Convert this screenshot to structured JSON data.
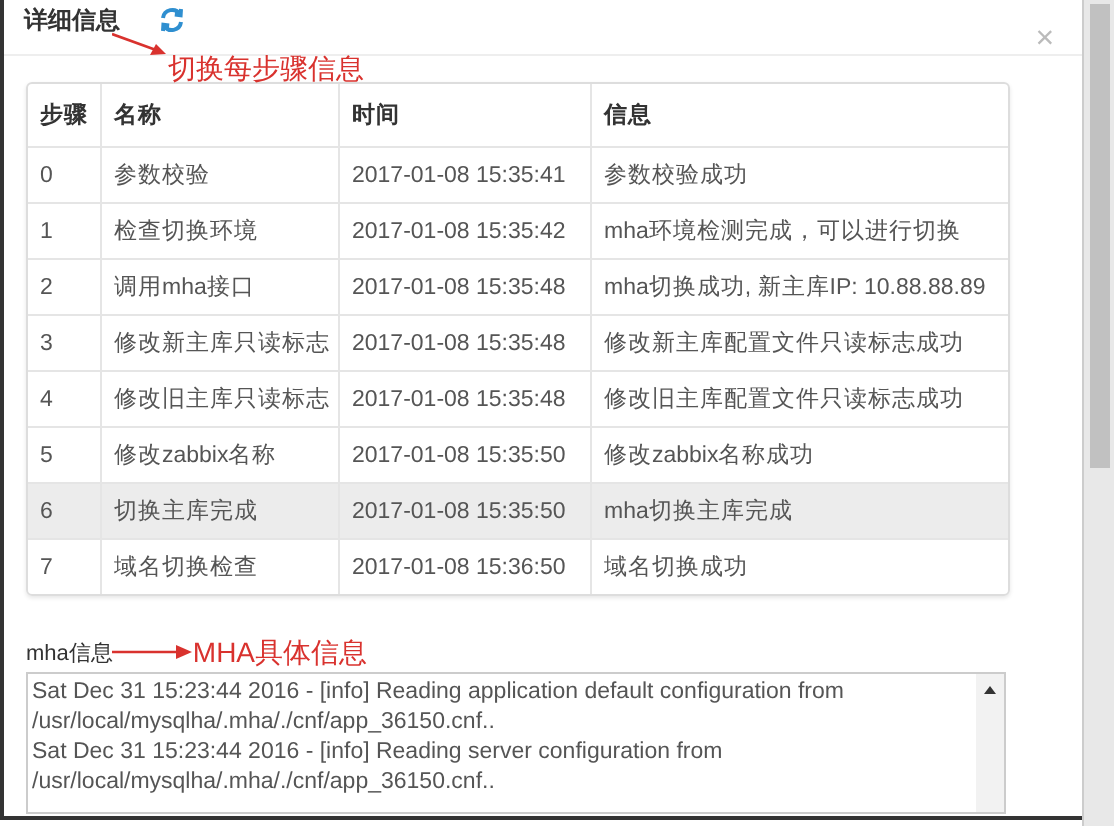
{
  "dialog": {
    "title": "详细信息",
    "close": "×"
  },
  "annotations": [
    {
      "text": "切换每步骤信息"
    },
    {
      "text": "MHA具体信息"
    }
  ],
  "table": {
    "columns": [
      "步骤",
      "名称",
      "时间",
      "信息"
    ],
    "rows": [
      {
        "cells": [
          "0",
          "参数校验",
          "2017-01-08 15:35:41",
          "参数校验成功"
        ],
        "highlighted": false
      },
      {
        "cells": [
          "1",
          "检查切换环境",
          "2017-01-08 15:35:42",
          "mha环境检测完成，可以进行切换"
        ],
        "highlighted": false
      },
      {
        "cells": [
          "2",
          "调用mha接口",
          "2017-01-08 15:35:48",
          "mha切换成功, 新主库IP: 10.88.88.89"
        ],
        "highlighted": false
      },
      {
        "cells": [
          "3",
          "修改新主库只读标志",
          "2017-01-08 15:35:48",
          "修改新主库配置文件只读标志成功"
        ],
        "highlighted": false
      },
      {
        "cells": [
          "4",
          "修改旧主库只读标志",
          "2017-01-08 15:35:48",
          "修改旧主库配置文件只读标志成功"
        ],
        "highlighted": false
      },
      {
        "cells": [
          "5",
          "修改zabbix名称",
          "2017-01-08 15:35:50",
          "修改zabbix名称成功"
        ],
        "highlighted": false
      },
      {
        "cells": [
          "6",
          "切换主库完成",
          "2017-01-08 15:35:50",
          "mha切换主库完成"
        ],
        "highlighted": true
      },
      {
        "cells": [
          "7",
          "域名切换检查",
          "2017-01-08 15:36:50",
          "域名切换成功"
        ],
        "highlighted": false
      }
    ]
  },
  "log": {
    "label": "mha信息",
    "lines": [
      "Sat Dec 31 15:23:44 2016 - [info] Reading application default configuration from",
      "/usr/local/mysqlha/.mha/./cnf/app_36150.cnf..",
      "Sat Dec 31 15:23:44 2016 - [info] Reading server configuration from",
      "/usr/local/mysqlha/.mha/./cnf/app_36150.cnf.."
    ]
  }
}
